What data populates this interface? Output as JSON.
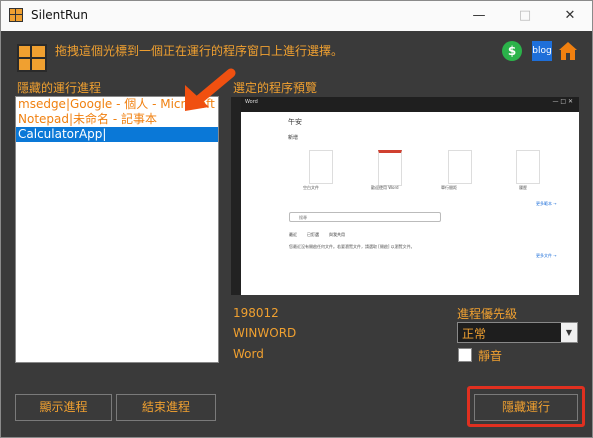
{
  "window": {
    "title": "SilentRun",
    "min_icon": "minimize-icon",
    "max_icon": "maximize-icon",
    "close_icon": "close-icon"
  },
  "header": {
    "instruction": "拖拽這個光標到一個正在運行的程序窗口上進行選擇。",
    "drag_icon": "crosshair-target-icon"
  },
  "toolbar_icons": {
    "dollar": "$",
    "blue_icon": "blog",
    "home_icon": "home-icon"
  },
  "left": {
    "label": "隱藏的運行進程",
    "items": [
      "msedge|Google - 個人 - Microsoft Edge",
      "Notepad|未命名 - 記事本",
      "CalculatorApp|"
    ],
    "selected_index": 2,
    "show_button": "顯示進程",
    "end_button": "結束進程"
  },
  "right": {
    "label": "選定的程序預覽",
    "pid": "198012",
    "exe": "WINWORD",
    "app_name": "Word",
    "priority_label": "進程優先級",
    "priority_value": "正常",
    "mute_label": "靜音",
    "hide_button": "隱藏運行"
  },
  "preview": {
    "app_title": "Word",
    "greeting": "午安",
    "new_label": "新增",
    "templates": [
      "空白文件",
      "歡迎使用 Word",
      "單行間距",
      "履歷"
    ],
    "more_templates": "更多範本 →",
    "search_placeholder": "搜尋",
    "tabs": [
      "最近",
      "已釘選",
      "與我共用"
    ],
    "empty_text": "您最近沒有開啟任何文件。若要瀏覽文件，請選取 [開啟] 以瀏覽文件。",
    "more_docs": "更多文件 →"
  },
  "colors": {
    "accent": "#f0a030",
    "background": "#3a3a3a",
    "selection": "#0a78d7",
    "highlight": "#e03020"
  }
}
